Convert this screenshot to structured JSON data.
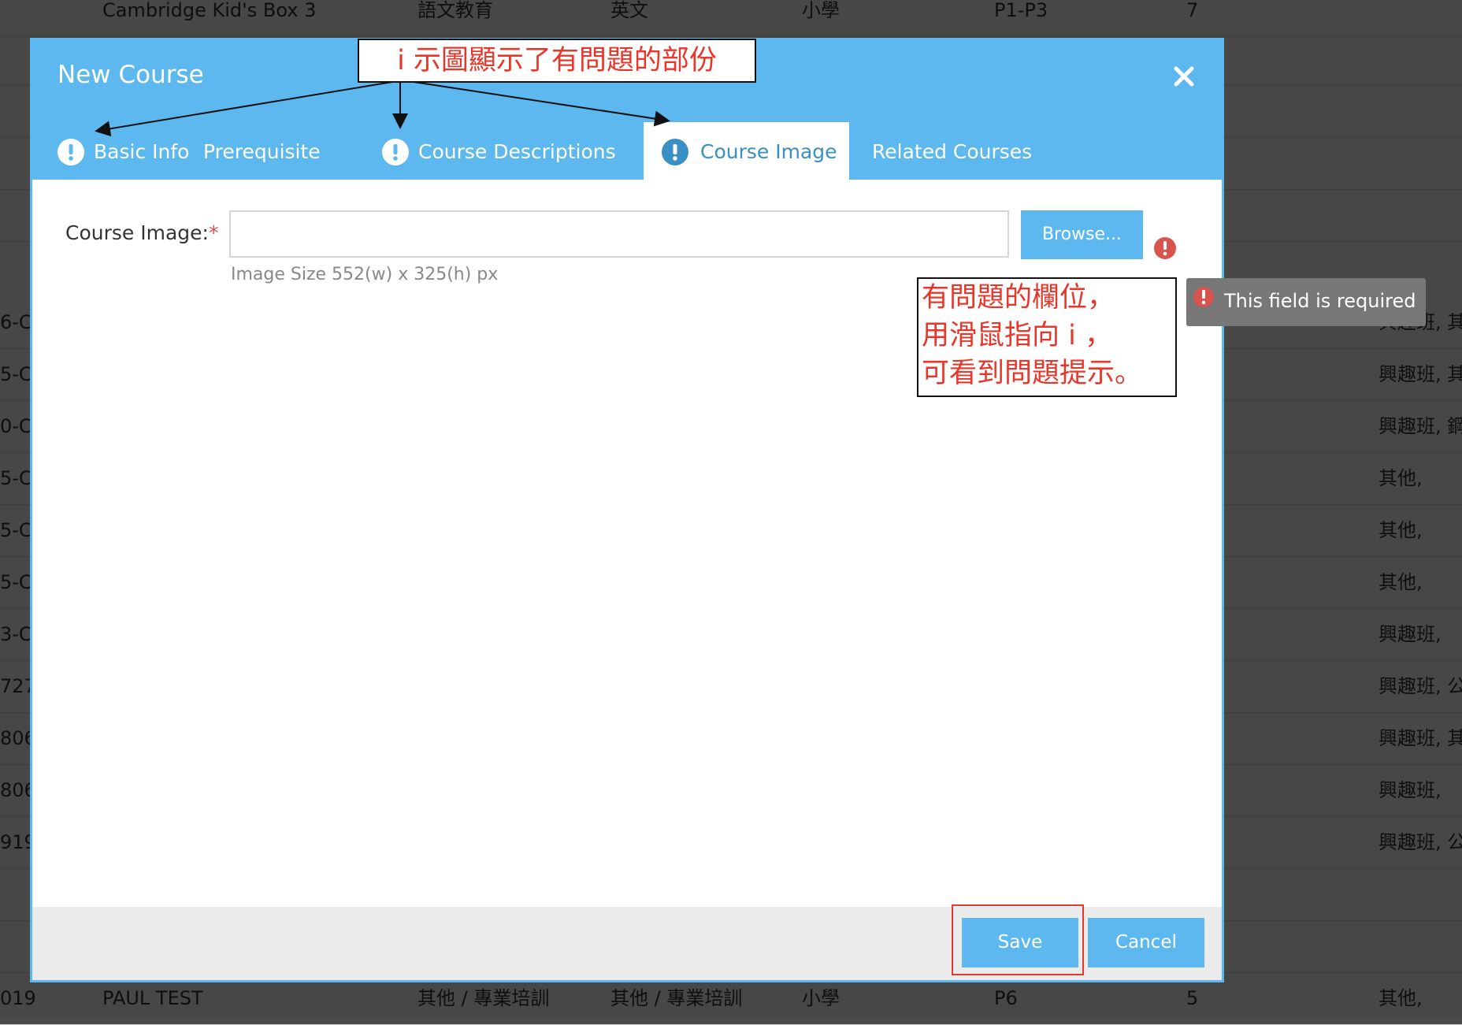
{
  "background_table": {
    "rows": [
      {
        "code": "",
        "name": "Cambridge Kid's Box 3",
        "category": "語文教育",
        "subject": "英文",
        "level": "小學",
        "grade": "P1-P3",
        "count": "7",
        "tags": ""
      },
      {
        "code": "",
        "name": "",
        "category": "",
        "subject": "",
        "level": "",
        "grade": "",
        "count": "",
        "tags": ""
      },
      {
        "code": "",
        "name": "",
        "category": "",
        "subject": "",
        "level": "",
        "grade": "",
        "count": "",
        "tags": ""
      },
      {
        "code": "",
        "name": "",
        "category": "",
        "subject": "",
        "level": "",
        "grade": "",
        "count": "",
        "tags": ""
      },
      {
        "code": "",
        "name": "",
        "category": "",
        "subject": "",
        "level": "",
        "grade": "",
        "count": "",
        "tags": ""
      },
      {
        "code": "6-C",
        "name": "",
        "category": "",
        "subject": "",
        "level": "",
        "grade": "",
        "count": "",
        "tags": "興趣班, 其"
      },
      {
        "code": "5-C",
        "name": "",
        "category": "",
        "subject": "",
        "level": "",
        "grade": "",
        "count": "",
        "tags": "興趣班, 其"
      },
      {
        "code": "0-C",
        "name": "",
        "category": "",
        "subject": "",
        "level": "",
        "grade": "",
        "count": "",
        "tags": "興趣班, 鋼"
      },
      {
        "code": "5-C",
        "name": "",
        "category": "",
        "subject": "",
        "level": "",
        "grade": "",
        "count": "",
        "tags": "其他,"
      },
      {
        "code": "5-C",
        "name": "",
        "category": "",
        "subject": "",
        "level": "",
        "grade": "",
        "count": "",
        "tags": "其他,"
      },
      {
        "code": "5-C",
        "name": "",
        "category": "",
        "subject": "",
        "level": "",
        "grade": "",
        "count": "",
        "tags": "其他,"
      },
      {
        "code": "3-C",
        "name": "",
        "category": "",
        "subject": "",
        "level": "",
        "grade": "",
        "count": "",
        "tags": "興趣班,"
      },
      {
        "code": "727",
        "name": "",
        "category": "",
        "subject": "",
        "level": "",
        "grade": "",
        "count": "",
        "tags": "興趣班, 公"
      },
      {
        "code": "806",
        "name": "",
        "category": "",
        "subject": "",
        "level": "",
        "grade": "",
        "count": "",
        "tags": "興趣班, 其"
      },
      {
        "code": "806",
        "name": "",
        "category": "",
        "subject": "",
        "level": "",
        "grade": "",
        "count": "",
        "tags": "興趣班,"
      },
      {
        "code": "919",
        "name": "",
        "category": "",
        "subject": "",
        "level": "",
        "grade": "",
        "count": "",
        "tags": "興趣班, 公"
      },
      {
        "code": "",
        "name": "",
        "category": "",
        "subject": "",
        "level": "",
        "grade": "",
        "count": "",
        "tags": ""
      },
      {
        "code": "",
        "name": "",
        "category": "",
        "subject": "",
        "level": "",
        "grade": "",
        "count": "",
        "tags": ""
      },
      {
        "code": "019",
        "name": "PAUL TEST",
        "category": "其他 / 專業培訓",
        "subject": "其他 / 專業培訓",
        "level": "小學",
        "grade": "P6",
        "count": "5",
        "tags": "其他,"
      }
    ]
  },
  "modal": {
    "title": "New Course",
    "close_icon": "close-icon",
    "tabs": [
      {
        "label": "Basic Info",
        "has_error": true,
        "active": false
      },
      {
        "label": "Prerequisite",
        "has_error": false,
        "active": false
      },
      {
        "label": "Course Descriptions",
        "has_error": true,
        "active": false
      },
      {
        "label": "Course Image",
        "has_error": true,
        "active": true
      },
      {
        "label": "Related Courses",
        "has_error": false,
        "active": false
      }
    ],
    "form": {
      "label": "Course Image:",
      "required_mark": "*",
      "input_value": "",
      "browse_label": "Browse...",
      "hint": "Image Size 552(w) x 325(h) px",
      "error_icon": "exclamation-circle-icon"
    },
    "footer": {
      "save_label": "Save",
      "cancel_label": "Cancel"
    }
  },
  "tooltip": {
    "text": "This field is required"
  },
  "annotations": {
    "top": "i 示圖顯示了有問題的部份",
    "right_lines": [
      "有問題的欄位，",
      "用滑鼠指向 i ，",
      "可看到問題提示。"
    ]
  },
  "colors": {
    "accent": "#5db8f0",
    "active_tab_text": "#3a8fc4",
    "error": "#d9534f",
    "annotation": "#e8372a"
  }
}
